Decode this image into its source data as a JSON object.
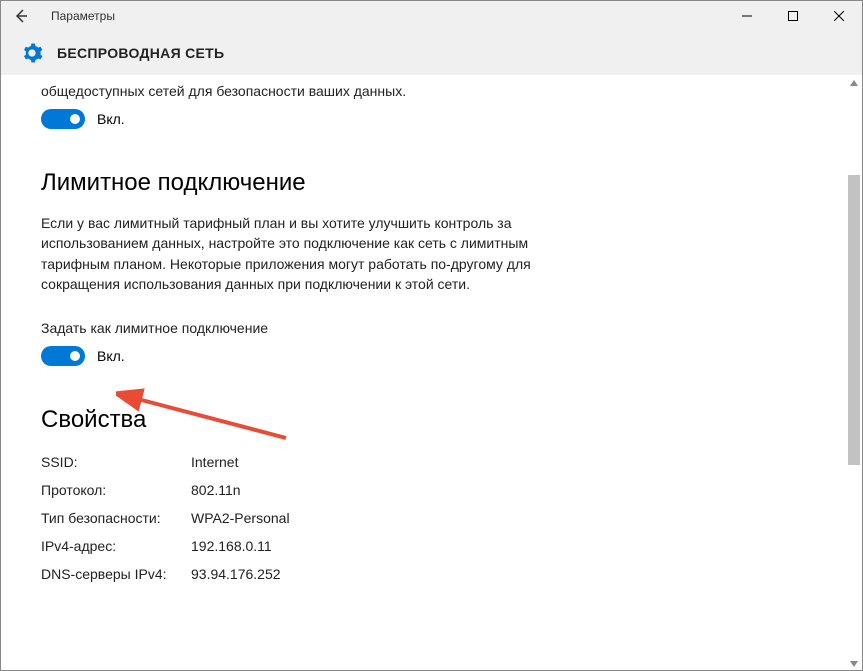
{
  "titlebar": {
    "app_title": "Параметры"
  },
  "header": {
    "title": "БЕСПРОВОДНАЯ СЕТЬ"
  },
  "partial_top": {
    "description": "общедоступных сетей для безопасности ваших данных.",
    "toggle_label": "Вкл."
  },
  "metered": {
    "heading": "Лимитное подключение",
    "description": "Если у вас лимитный тарифный план и вы хотите улучшить контроль за использованием данных, настройте это подключение как сеть с лимитным тарифным планом. Некоторые приложения могут работать по-другому для сокращения использования данных при подключении к этой сети.",
    "sublabel": "Задать как лимитное подключение",
    "toggle_label": "Вкл."
  },
  "properties": {
    "heading": "Свойства",
    "rows": [
      {
        "key": "SSID:",
        "val": "Internet"
      },
      {
        "key": "Протокол:",
        "val": "802.11n"
      },
      {
        "key": "Тип безопасности:",
        "val": "WPA2-Personal"
      },
      {
        "key": "IPv4-адрес:",
        "val": "192.168.0.11"
      },
      {
        "key": "DNS-серверы IPv4:",
        "val": "93.94.176.252"
      }
    ]
  },
  "colors": {
    "accent": "#0078d7",
    "arrow": "#e94b35"
  }
}
